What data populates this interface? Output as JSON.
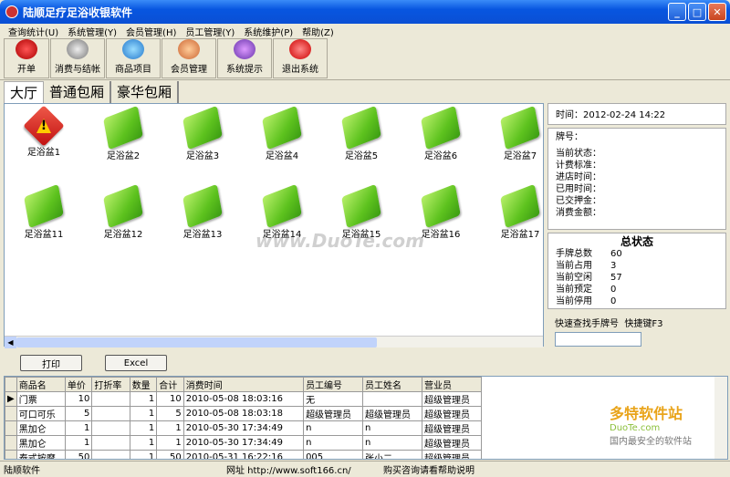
{
  "window": {
    "title": "陆顺足疗足浴收银软件"
  },
  "menu": [
    "查询统计(U)",
    "系统管理(Y)",
    "会员管理(H)",
    "员工管理(Y)",
    "系统维护(P)",
    "帮助(Z)"
  ],
  "toolbar": [
    {
      "label": "开单",
      "icon": "pen-icon"
    },
    {
      "label": "消费与结帐",
      "icon": "money-bag-icon"
    },
    {
      "label": "商品项目",
      "icon": "apple-icon"
    },
    {
      "label": "会员管理",
      "icon": "members-icon"
    },
    {
      "label": "系统提示",
      "icon": "info-icon"
    },
    {
      "label": "退出系统",
      "icon": "stop-icon"
    }
  ],
  "tabs": [
    "大厅",
    "普通包厢",
    "豪华包厢"
  ],
  "tiles": [
    "足浴盆1",
    "足浴盆2",
    "足浴盆3",
    "足浴盆4",
    "足浴盆5",
    "足浴盆6",
    "足浴盆7",
    "足浴盆11",
    "足浴盆12",
    "足浴盆13",
    "足浴盆14",
    "足浴盆15",
    "足浴盆16",
    "足浴盆17"
  ],
  "info": {
    "time_label": "时间：",
    "time": "2012-02-24 14:22",
    "fields": [
      "牌号：",
      "当前状态：",
      "计费标准：",
      "进店时间：",
      "已用时间：",
      "已交押金：",
      "消费金额："
    ]
  },
  "status": {
    "title": "总状态",
    "rows": [
      [
        "手牌总数",
        "60"
      ],
      [
        "当前占用",
        "3"
      ],
      [
        "当前空闲",
        "57"
      ],
      [
        "当前预定",
        "0"
      ],
      [
        "当前停用",
        "0"
      ]
    ]
  },
  "quick": {
    "label": "快速查找手牌号",
    "hotkey": "快捷键F3"
  },
  "buttons": {
    "print": "打印",
    "excel": "Excel"
  },
  "table": {
    "headers": [
      "商品名",
      "单价",
      "打折率",
      "数量",
      "合计",
      "消费时间",
      "员工编号",
      "员工姓名",
      "营业员"
    ],
    "rows": [
      [
        "门票",
        "10",
        "",
        "1",
        "10",
        "2010-05-08 18:03:16",
        "无",
        "",
        "超级管理员"
      ],
      [
        "可口可乐",
        "5",
        "",
        "1",
        "5",
        "2010-05-08 18:03:18",
        "超级管理员",
        "超级管理员",
        "超级管理员"
      ],
      [
        "黑加仑",
        "1",
        "",
        "1",
        "1",
        "2010-05-30 17:34:49",
        "n",
        "n",
        "超级管理员"
      ],
      [
        "黑加仑",
        "1",
        "",
        "1",
        "1",
        "2010-05-30 17:34:49",
        "n",
        "n",
        "超级管理员"
      ],
      [
        "泰式按摩",
        "50",
        "",
        "1",
        "50",
        "2010-05-31 16:22:16",
        "005",
        "张小二",
        "超级管理员"
      ]
    ]
  },
  "statusbar": {
    "app": "陆顺软件",
    "site_label": "网址 http://www.soft166.cn/",
    "help": "购买咨询请看帮助说明"
  },
  "watermark": "www.DuoTe.com",
  "logo_wm": [
    "多特软件站",
    "DuoTe.com",
    "国内最安全的软件站"
  ]
}
